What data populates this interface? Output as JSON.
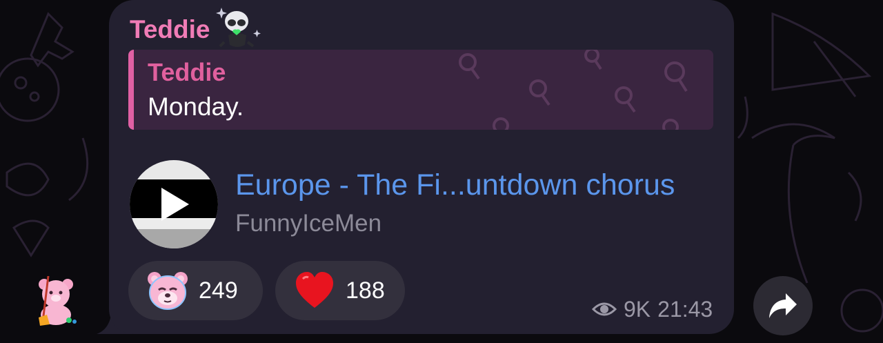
{
  "message": {
    "sender_name": "Teddie",
    "quote": {
      "author": "Teddie",
      "text": "Monday."
    },
    "track": {
      "title": "Europe - The Fi...untdown chorus",
      "artist": "FunnyIceMen"
    },
    "reactions": [
      {
        "emoji": "bear-face-emoji",
        "count": "249"
      },
      {
        "emoji": "red-heart-emoji",
        "count": "188"
      }
    ],
    "views": "9K",
    "time": "21:43"
  },
  "icons": {
    "avatar": "teddy-bear-avatar",
    "sender_badge": "panda-sticker-icon",
    "play": "play-icon",
    "views": "eye-icon",
    "share": "share-arrow-icon"
  },
  "colors": {
    "bubble": "#232030",
    "sender": "#f07cb6",
    "link": "#5b96ec",
    "muted": "#9b98a6"
  }
}
